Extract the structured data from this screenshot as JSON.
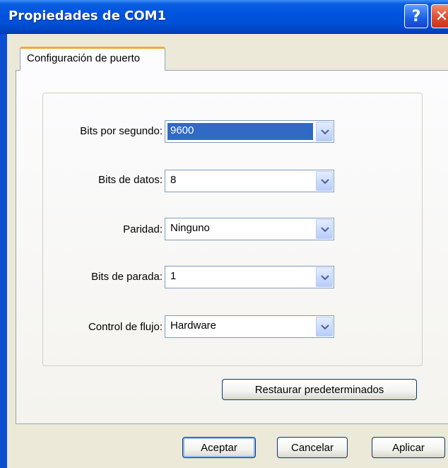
{
  "window": {
    "title": "Propiedades de COM1",
    "help_icon": "?",
    "close_icon": "✕"
  },
  "tabs": [
    {
      "label": "Configuración de puerto",
      "active": true
    }
  ],
  "settings": [
    {
      "label": "Bits por segundo:",
      "value": "9600",
      "selected": true
    },
    {
      "label": "Bits de datos:",
      "value": "8"
    },
    {
      "label": "Paridad:",
      "value": "Ninguno"
    },
    {
      "label": "Bits de parada:",
      "value": "1"
    },
    {
      "label": "Control de flujo:",
      "value": "Hardware"
    }
  ],
  "restore_button": "Restaurar predeterminados",
  "buttons": {
    "ok": "Aceptar",
    "cancel": "Cancelar",
    "apply": "Aplicar"
  },
  "colors": {
    "titlebar": "#0053e0",
    "selection": "#316ac5",
    "window_bg": "#ECE9D8"
  }
}
